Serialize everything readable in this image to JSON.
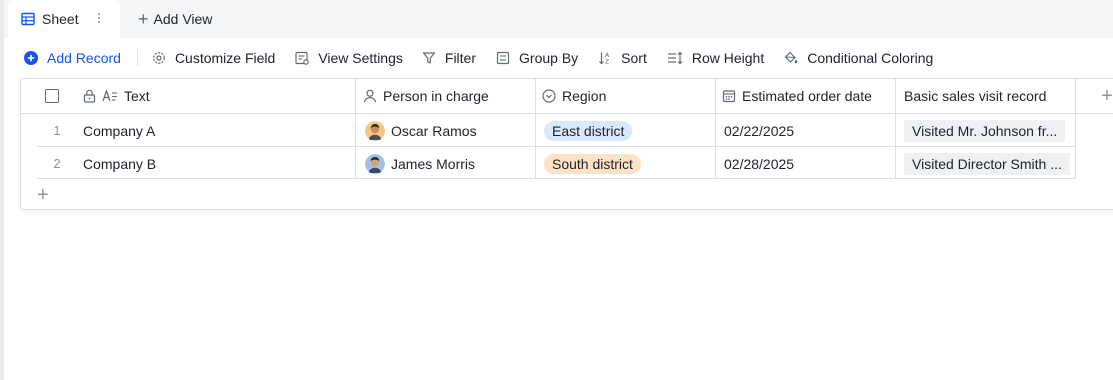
{
  "tabs": {
    "active_label": "Sheet",
    "add_view_label": "Add View"
  },
  "toolbar": {
    "add_record": "Add Record",
    "customize_field": "Customize Field",
    "view_settings": "View Settings",
    "filter": "Filter",
    "group_by": "Group By",
    "sort": "Sort",
    "row_height": "Row Height",
    "conditional_coloring": "Conditional Coloring"
  },
  "columns": {
    "text": "Text",
    "person": "Person in charge",
    "region": "Region",
    "date": "Estimated order date",
    "record": "Basic sales visit record"
  },
  "rows": [
    {
      "num": "1",
      "text": "Company A",
      "person": "Oscar Ramos",
      "region": "East district",
      "date": "02/22/2025",
      "record": "Visited Mr. Johnson fr..."
    },
    {
      "num": "2",
      "text": "Company B",
      "person": "James Morris",
      "region": "South district",
      "date": "02/28/2025",
      "record": "Visited Director Smith ..."
    }
  ],
  "colors": {
    "accent": "#1456f0",
    "east_tag": "#d9e8fc",
    "south_tag": "#fde2c8"
  }
}
